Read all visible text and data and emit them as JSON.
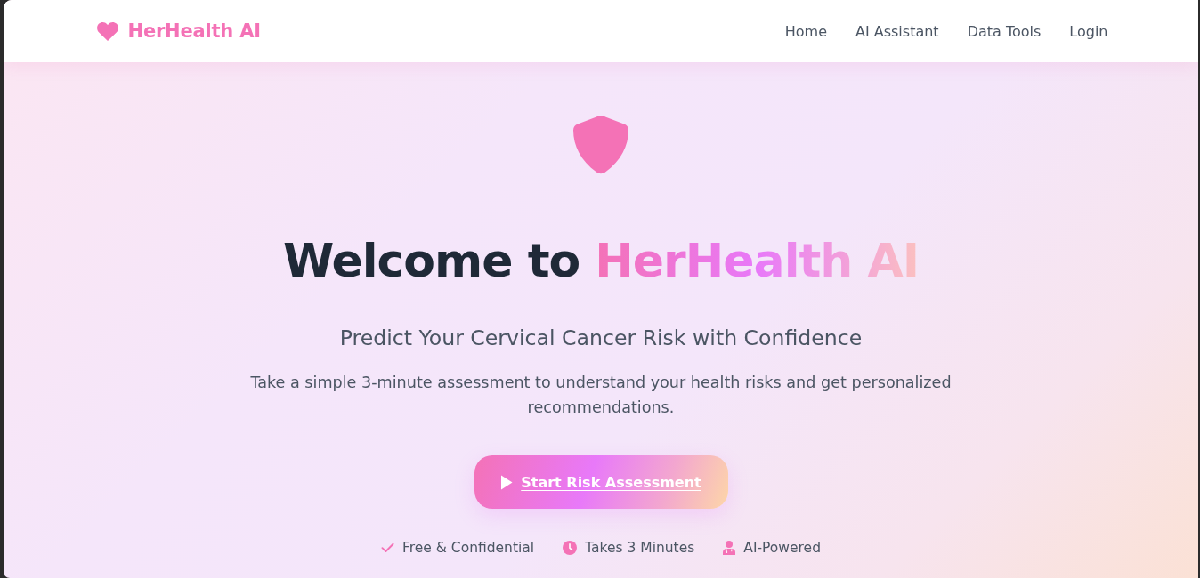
{
  "brand": {
    "name": "HerHealth AI"
  },
  "nav_links": [
    "Home",
    "AI Assistant",
    "Data Tools",
    "Login"
  ],
  "hero": {
    "heading": {
      "text": "Welcome to",
      "highlight": "HerHealth AI"
    },
    "subtitle": "Predict Your Cervical Cancer Risk with Confidence",
    "description": "Take a simple 3-minute assessment to understand your health risks and get personalized recommendations.",
    "cta": {
      "label": "Start Risk Assessment"
    },
    "features": [
      "Free & Confidential",
      "Takes 3 Minutes",
      "AI-Powered"
    ]
  }
}
